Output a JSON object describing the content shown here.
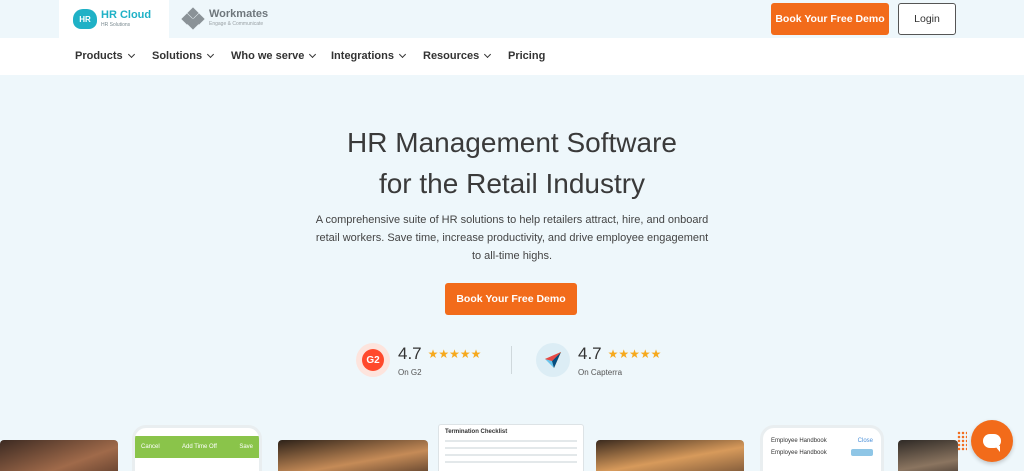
{
  "header": {
    "hr_badge": "HR",
    "hr_cloud_name": "HR Cloud",
    "hr_cloud_tagline": "HR Solutions",
    "workmates_name": "Workmates",
    "workmates_tagline": "Engage & Communicate",
    "demo_label": "Book Your Free Demo",
    "login_label": "Login"
  },
  "nav": {
    "items": [
      {
        "label": "Products",
        "has_dropdown": true
      },
      {
        "label": "Solutions",
        "has_dropdown": true
      },
      {
        "label": "Who we serve",
        "has_dropdown": true
      },
      {
        "label": "Integrations",
        "has_dropdown": true
      },
      {
        "label": "Resources",
        "has_dropdown": true
      },
      {
        "label": "Pricing",
        "has_dropdown": false
      }
    ]
  },
  "hero": {
    "title_line1": "HR Management Software",
    "title_line2": "for the Retail Industry",
    "subtitle_line1": "A comprehensive suite of HR solutions to help retailers attract, hire, and onboard",
    "subtitle_line2": "retail workers. Save time, increase productivity, and drive employee engagement",
    "subtitle_line3": "to all-time highs.",
    "cta_label": "Book Your Free Demo"
  },
  "ratings": [
    {
      "score": "4.7",
      "stars": "★★★★★",
      "label": "On G2",
      "logo_text": "G2"
    },
    {
      "score": "4.7",
      "stars": "★★★★★",
      "label": "On Capterra"
    }
  ],
  "preview": {
    "phone1_cancel": "Cancel",
    "phone1_title": "Add Time Off",
    "phone1_save": "Save",
    "doc_title": "Termination Checklist",
    "phone2_title": "Employee Handbook",
    "phone2_close": "Close",
    "phone2_item": "Employee Handbook"
  },
  "colors": {
    "accent": "#f26b1a",
    "brand_teal": "#1fb1c6",
    "hero_bg": "#eef7fb",
    "star": "#f6a91d"
  }
}
